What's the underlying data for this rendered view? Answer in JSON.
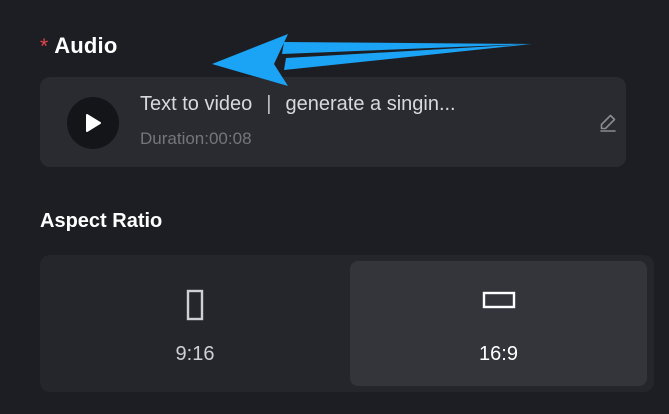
{
  "audio": {
    "required_marker": "*",
    "title": "Audio",
    "track_name": "Text to video",
    "separator": "|",
    "track_prompt": "generate a singin...",
    "duration": "Duration:00:08"
  },
  "aspect_ratio": {
    "title": "Aspect Ratio",
    "selected": "16:9",
    "options": [
      {
        "label": "9:16",
        "selected": false
      },
      {
        "label": "16:9",
        "selected": true
      }
    ]
  },
  "icons": {
    "play": "play-icon",
    "edit": "pencil-icon",
    "portrait": "portrait-rect-icon",
    "landscape": "landscape-rect-icon",
    "annotation": "arrow-pointer"
  },
  "colors": {
    "background": "#1d1e23",
    "card": "#2a2b30",
    "selected_option": "#34353b",
    "required": "#e8454a",
    "annotation_arrow": "#1ba3f5"
  }
}
